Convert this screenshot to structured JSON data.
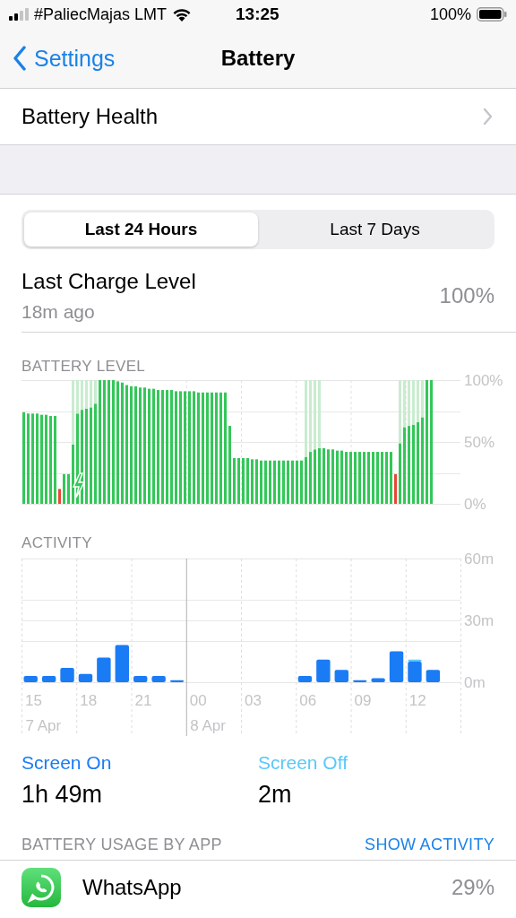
{
  "status_bar": {
    "carrier": "#PaliecMajas LMT",
    "time": "13:25",
    "battery": "100%"
  },
  "nav": {
    "back": "Settings",
    "title": "Battery"
  },
  "health_row": {
    "label": "Battery Health"
  },
  "segments": [
    {
      "label": "Last 24 Hours",
      "selected": true
    },
    {
      "label": "Last 7 Days",
      "selected": false
    }
  ],
  "last_charge": {
    "title": "Last Charge Level",
    "subtitle": "18m ago",
    "value": "100%"
  },
  "battery_level": {
    "heading": "BATTERY LEVEL",
    "chart_data": {
      "type": "bar",
      "stacked": true,
      "ref_lines": [
        {
          "axis": "y",
          "value": 25
        },
        {
          "axis": "y",
          "value": 50
        },
        {
          "axis": "y",
          "value": 75
        }
      ],
      "ylim": [
        0,
        100
      ],
      "yticks": [
        {
          "value": 100,
          "label": "100%"
        },
        {
          "value": 50,
          "label": "50%"
        },
        {
          "value": 0,
          "label": "0%"
        }
      ],
      "series": [
        {
          "color": "#34c759",
          "values": [
            74,
            73,
            73,
            73,
            72,
            72,
            71,
            71,
            0,
            24,
            24,
            48,
            73,
            76,
            77,
            78,
            81,
            100,
            100,
            100,
            100,
            99,
            98,
            96,
            95,
            95,
            94,
            94,
            93,
            93,
            92,
            92,
            92,
            92,
            91,
            91,
            91,
            91,
            91,
            90,
            90,
            90,
            90,
            90,
            90,
            90,
            63,
            37,
            37,
            37,
            37,
            36,
            36,
            35,
            35,
            35,
            35,
            35,
            35,
            35,
            35,
            35,
            35,
            38,
            42,
            44,
            45,
            45,
            44,
            44,
            43,
            43,
            42,
            42,
            42,
            42,
            42,
            42,
            42,
            42,
            42,
            42,
            42,
            0,
            49,
            62,
            63,
            64,
            66,
            70,
            100,
            100
          ]
        },
        {
          "color": "#e5483a",
          "values": [
            0,
            0,
            0,
            0,
            0,
            0,
            0,
            0,
            12,
            0,
            0,
            0,
            0,
            0,
            0,
            0,
            0,
            0,
            0,
            0,
            0,
            0,
            0,
            0,
            0,
            0,
            0,
            0,
            0,
            0,
            0,
            0,
            0,
            0,
            0,
            0,
            0,
            0,
            0,
            0,
            0,
            0,
            0,
            0,
            0,
            0,
            0,
            0,
            0,
            0,
            0,
            0,
            0,
            0,
            0,
            0,
            0,
            0,
            0,
            0,
            0,
            0,
            0,
            0,
            0,
            0,
            0,
            0,
            0,
            0,
            0,
            0,
            0,
            0,
            0,
            0,
            0,
            0,
            0,
            0,
            0,
            0,
            0,
            24,
            0,
            0,
            0,
            0,
            0,
            0,
            0,
            0
          ]
        },
        {
          "color": "#c9eccf",
          "values": [
            0,
            0,
            0,
            0,
            0,
            0,
            0,
            0,
            0,
            0,
            0,
            52,
            27,
            24,
            23,
            22,
            19,
            0,
            0,
            0,
            0,
            0,
            0,
            0,
            0,
            0,
            0,
            0,
            0,
            0,
            0,
            0,
            0,
            0,
            0,
            0,
            0,
            0,
            0,
            0,
            0,
            0,
            0,
            0,
            0,
            0,
            0,
            0,
            0,
            0,
            0,
            0,
            0,
            0,
            0,
            0,
            0,
            0,
            0,
            0,
            0,
            0,
            0,
            62,
            58,
            56,
            55,
            0,
            0,
            0,
            0,
            0,
            0,
            0,
            0,
            0,
            0,
            0,
            0,
            0,
            0,
            0,
            0,
            0,
            51,
            38,
            37,
            36,
            34,
            30,
            0,
            0
          ]
        }
      ]
    }
  },
  "activity": {
    "heading": "ACTIVITY",
    "chart_data": {
      "type": "bar",
      "stacked": true,
      "ref_lines": [
        {
          "axis": "y",
          "value": 20
        },
        {
          "axis": "y",
          "value": 30
        },
        {
          "axis": "y",
          "value": 40
        }
      ],
      "ylim": [
        0,
        60
      ],
      "yticks": [
        {
          "value": 60,
          "label": "60m"
        },
        {
          "value": 30,
          "label": "30m"
        },
        {
          "value": 0,
          "label": "0m"
        }
      ],
      "categories": [
        "15",
        null,
        null,
        "18",
        null,
        null,
        "21",
        null,
        null,
        "00",
        null,
        null,
        "03",
        null,
        null,
        "06",
        null,
        null,
        "09",
        null,
        null,
        "12",
        null
      ],
      "series": [
        {
          "name": "Screen On",
          "color": "#1a7cf5",
          "values": [
            3,
            3,
            7,
            4,
            12,
            18,
            3,
            3,
            1,
            0,
            0,
            0,
            0,
            0,
            0,
            3,
            11,
            6,
            1,
            2,
            15,
            10,
            6
          ]
        },
        {
          "name": "Screen Off",
          "color": "#5ac8fa",
          "values": [
            0,
            0,
            0,
            0,
            0,
            0,
            0,
            0,
            0,
            0,
            0,
            0,
            0,
            0,
            0,
            0,
            0,
            0,
            0,
            0,
            0,
            1,
            0
          ]
        }
      ],
      "annotations": [
        "7 Apr",
        "8 Apr"
      ]
    }
  },
  "screen_totals": [
    {
      "value": "1h 49m"
    },
    {
      "value": "2m"
    }
  ],
  "usage": {
    "heading": "BATTERY USAGE BY APP",
    "action": "SHOW ACTIVITY",
    "apps": [
      {
        "name": "WhatsApp",
        "share": "29%"
      }
    ]
  }
}
